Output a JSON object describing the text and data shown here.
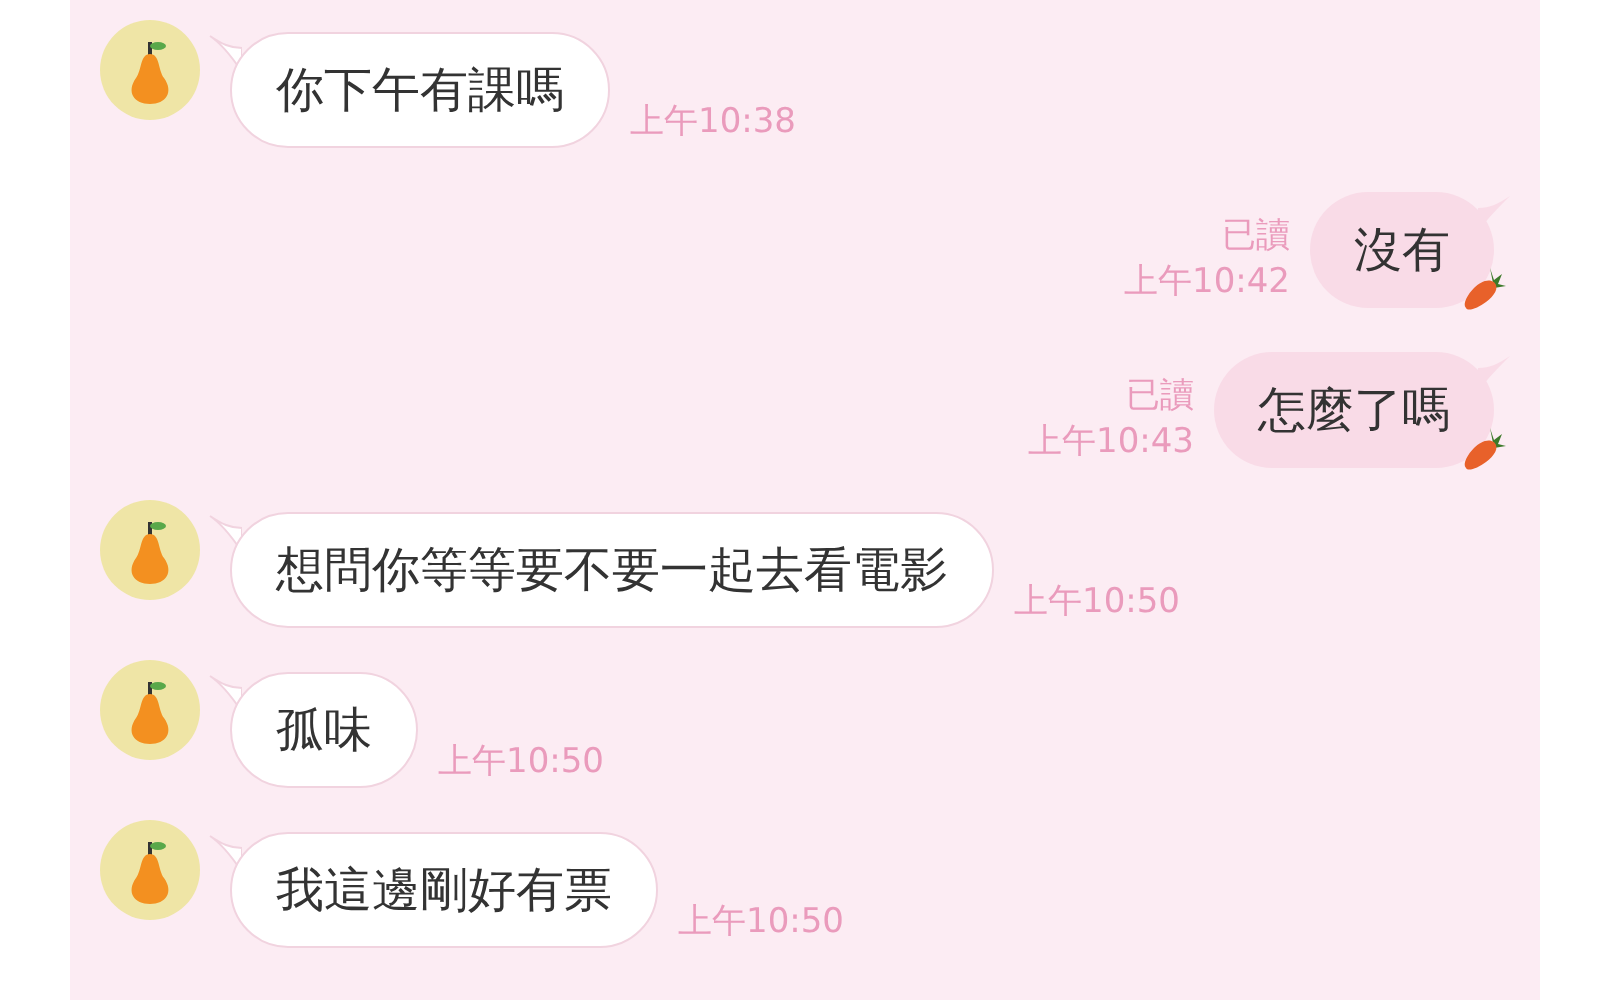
{
  "messages": [
    {
      "kind": "incoming",
      "text": "你下午有課嗎",
      "time": "上午10:38"
    },
    {
      "kind": "outgoing",
      "text": "沒有",
      "read_label": "已讀",
      "time": "上午10:42"
    },
    {
      "kind": "outgoing",
      "text": "怎麼了嗎",
      "read_label": "已讀",
      "time": "上午10:43"
    },
    {
      "kind": "incoming",
      "text": "想問你等等要不要一起去看電影",
      "time": "上午10:50"
    },
    {
      "kind": "incoming",
      "text": "孤味",
      "time": "上午10:50"
    },
    {
      "kind": "incoming",
      "text": "我這邊剛好有票",
      "time": "上午10:50"
    }
  ]
}
